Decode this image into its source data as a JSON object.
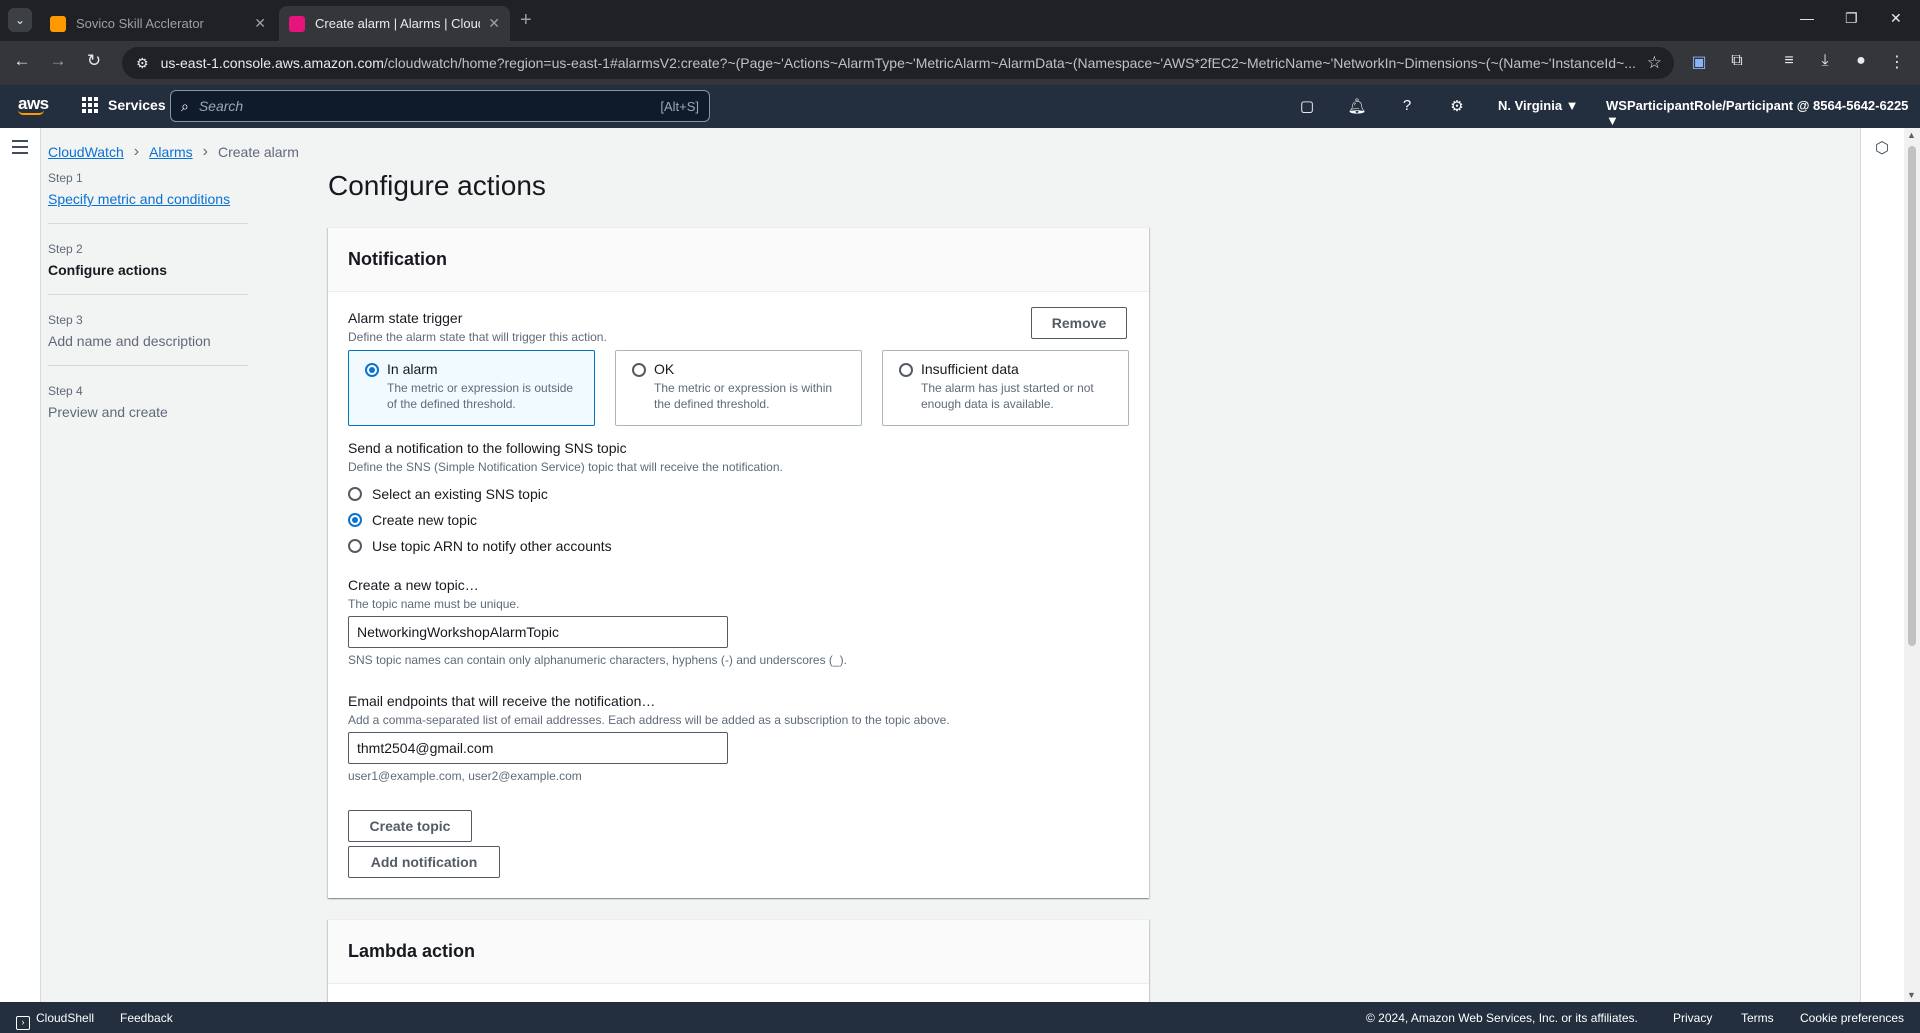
{
  "browser": {
    "tabs": [
      {
        "title": "Sovico Skill Acclerator",
        "active": false,
        "icon": "aws-cube-icon",
        "color": "#ff9900"
      },
      {
        "title": "Create alarm | Alarms | CloudW",
        "active": true,
        "icon": "cloudwatch-icon",
        "color": "#e7157b"
      }
    ],
    "url_host": "us-east-1.console.aws.amazon.com",
    "url_path": "/cloudwatch/home?region=us-east-1#alarmsV2:create?~(Page~'Actions~AlarmType~'MetricAlarm~AlarmData~(Namespace~'AWS*2fEC2~MetricName~'NetworkIn~Dimensions~(~(Name~'InstanceId~..."
  },
  "awsnav": {
    "logo": "aws",
    "services": "Services",
    "search_placeholder": "Search",
    "search_shortcut": "[Alt+S]",
    "region": "N. Virginia ▼",
    "account": "WSParticipantRole/Participant @ 8564-5642-6225 ▼"
  },
  "breadcrumb": {
    "items": [
      "CloudWatch",
      "Alarms"
    ],
    "current": "Create alarm"
  },
  "steps": [
    {
      "label": "Step 1",
      "name": "Specify metric and conditions",
      "state": "link"
    },
    {
      "label": "Step 2",
      "name": "Configure actions",
      "state": "active"
    },
    {
      "label": "Step 3",
      "name": "Add name and description",
      "state": "pending"
    },
    {
      "label": "Step 4",
      "name": "Preview and create",
      "state": "pending"
    }
  ],
  "main": {
    "title": "Configure actions",
    "notification": {
      "heading": "Notification",
      "remove_label": "Remove",
      "trigger_label": "Alarm state trigger",
      "trigger_desc": "Define the alarm state that will trigger this action.",
      "tiles": [
        {
          "title": "In alarm",
          "desc": "The metric or expression is outside of the defined threshold.",
          "selected": true
        },
        {
          "title": "OK",
          "desc": "The metric or expression is within the defined threshold.",
          "selected": false
        },
        {
          "title": "Insufficient data",
          "desc": "The alarm has just started or not enough data is available.",
          "selected": false
        }
      ],
      "sns_label": "Send a notification to the following SNS topic",
      "sns_desc": "Define the SNS (Simple Notification Service) topic that will receive the notification.",
      "sns_options": [
        {
          "label": "Select an existing SNS topic",
          "selected": false
        },
        {
          "label": "Create new topic",
          "selected": true
        },
        {
          "label": "Use topic ARN to notify other accounts",
          "selected": false
        }
      ],
      "topic_label": "Create a new topic…",
      "topic_desc": "The topic name must be unique.",
      "topic_value": "NetworkingWorkshopAlarmTopic",
      "topic_hint": "SNS topic names can contain only alphanumeric characters, hyphens (-) and underscores (_).",
      "email_label": "Email endpoints that will receive the notification…",
      "email_desc": "Add a comma-separated list of email addresses. Each address will be added as a subscription to the topic above.",
      "email_value": "thmt2504@gmail.com",
      "email_hint": "user1@example.com, user2@example.com",
      "create_topic_label": "Create topic",
      "add_notification_label": "Add notification"
    },
    "lambda_heading": "Lambda action"
  },
  "footer": {
    "cloudshell": "CloudShell",
    "feedback": "Feedback",
    "copyright": "© 2024, Amazon Web Services, Inc. or its affiliates.",
    "privacy": "Privacy",
    "terms": "Terms",
    "cookies": "Cookie preferences"
  }
}
